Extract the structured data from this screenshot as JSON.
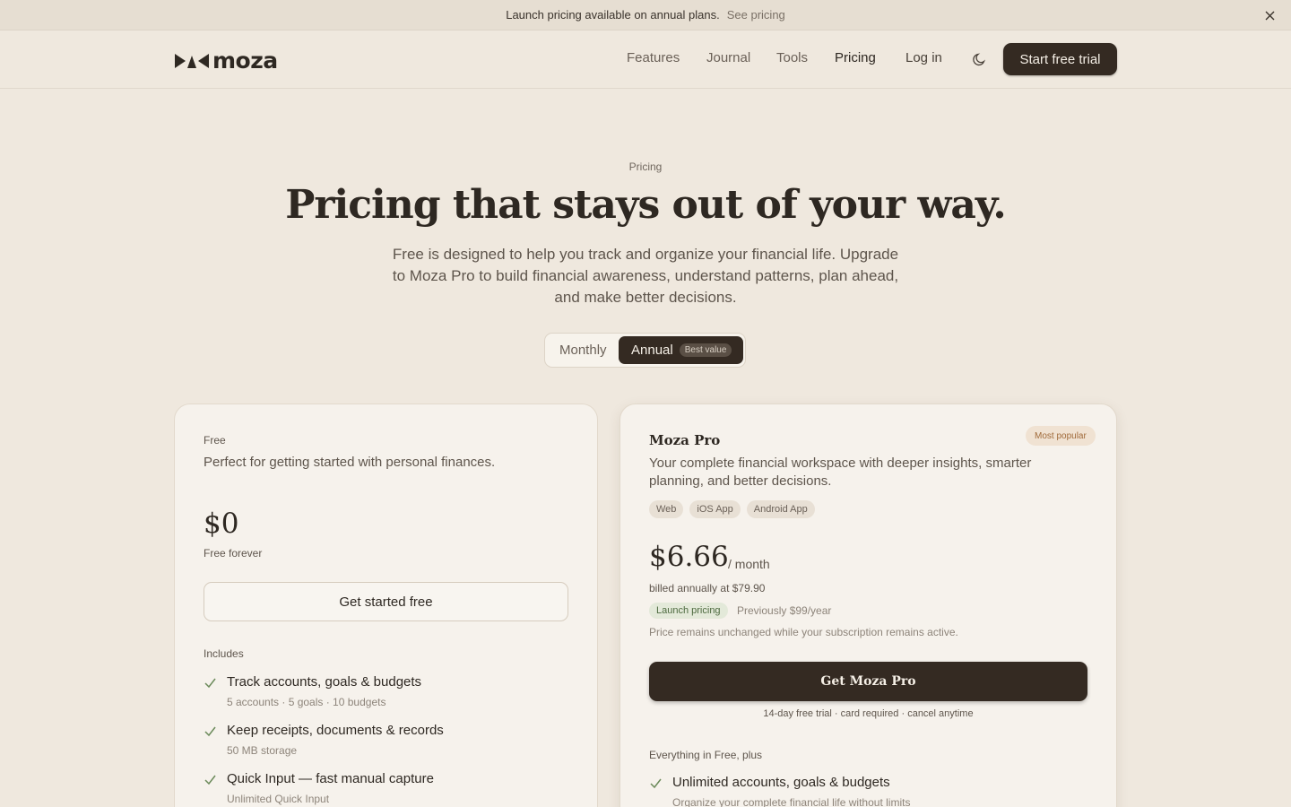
{
  "banner": {
    "message": "Launch pricing available on annual plans.",
    "link": "See pricing"
  },
  "nav": {
    "logo": "moza",
    "links": [
      "Features",
      "Journal",
      "Tools",
      "Pricing"
    ],
    "active": "Pricing",
    "login": "Log in",
    "cta": "Start free trial"
  },
  "hero": {
    "eyebrow": "Pricing",
    "title": "Pricing that stays out of your way.",
    "subtitle": "Free is designed to help you track and organize your financial life. Upgrade to Moza Pro to build financial awareness, understand patterns, plan ahead, and make better decisions."
  },
  "billing_toggle": {
    "monthly": "Monthly",
    "annual": "Annual",
    "annual_badge": "Best value",
    "selected": "Annual"
  },
  "free_plan": {
    "name": "Free",
    "description": "Perfect for getting started with personal finances.",
    "price": "$0",
    "price_note": "Free forever",
    "button": "Get started free",
    "includes_label": "Includes",
    "features": [
      {
        "title": "Track accounts, goals & budgets",
        "sub": "5 accounts · 5 goals · 10 budgets"
      },
      {
        "title": "Keep receipts, documents & records",
        "sub": "50 MB storage"
      },
      {
        "title": "Quick Input — fast manual capture",
        "sub": "Unlimited Quick Input"
      }
    ]
  },
  "pro_plan": {
    "name": "Moza Pro",
    "badge": "Most popular",
    "description": "Your complete financial workspace with deeper insights, smarter planning, and better decisions.",
    "platforms": [
      "Web",
      "iOS App",
      "Android App"
    ],
    "price": "$6.66",
    "period": "/ month",
    "billed": "billed annually at $79.90",
    "launch_badge": "Launch pricing",
    "previous": "Previously $99/year",
    "guarantee": "Price remains unchanged while your subscription remains active.",
    "button": "Get Moza Pro",
    "trial_note": "14-day free trial · card required · cancel anytime",
    "includes_label": "Everything in Free, plus",
    "features": [
      {
        "title": "Unlimited accounts, goals & budgets",
        "sub": "Organize your complete financial life without limits"
      }
    ]
  },
  "colors": {
    "background": "#efe8de",
    "primary_dark": "#342a22",
    "accent_badge": "#f0e2d2",
    "success_badge": "#e3e9d9"
  }
}
